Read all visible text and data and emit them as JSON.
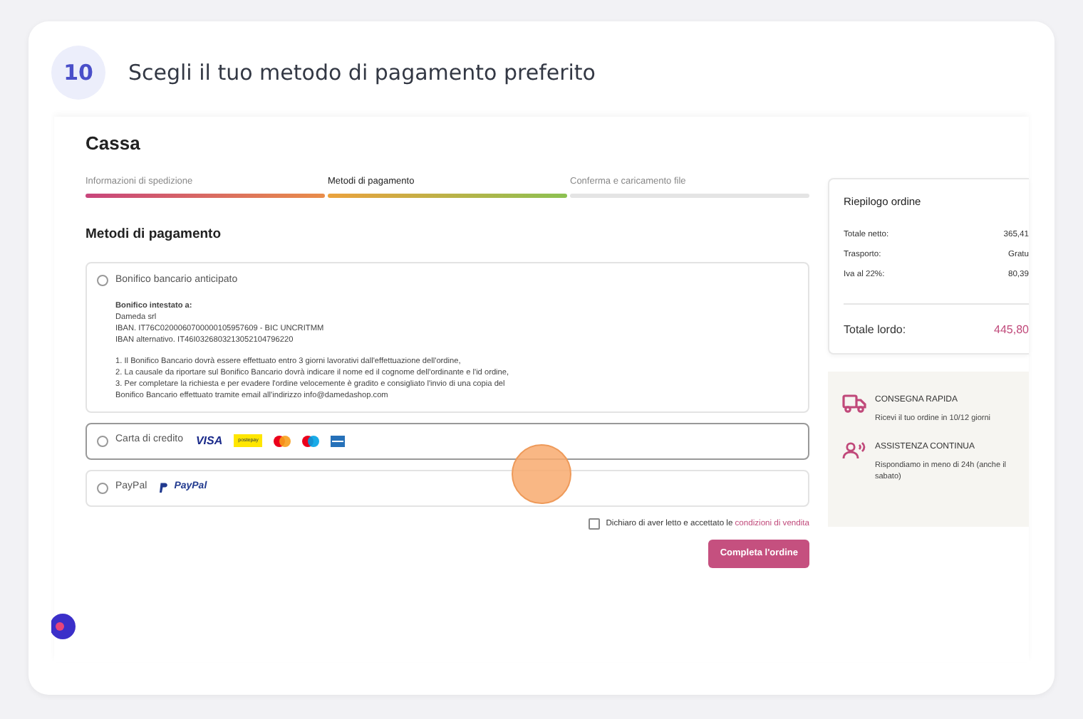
{
  "step": {
    "number": "10",
    "title": "Scegli il tuo metodo di pagamento preferito"
  },
  "checkout": {
    "title": "Cassa",
    "steps": [
      {
        "label": "Informazioni di spedizione",
        "completed": true,
        "selected": false
      },
      {
        "label": "Metodi di pagamento",
        "completed": false,
        "selected": true
      },
      {
        "label": "Conferma e caricamento file",
        "completed": false,
        "selected": false
      }
    ],
    "section_title": "Metodi di pagamento",
    "methods": [
      {
        "label": "Bonifico bancario anticipato",
        "selected": false,
        "hover": false,
        "details": {
          "heading": "Bonifico intestato a:",
          "lines": [
            "Dameda srl",
            "IBAN. IT76C0200060700000105957609 - BIC UNCRITMM",
            "IBAN alternativo. IT46I0326803213052104796220"
          ],
          "notes": [
            "1. Il Bonifico Bancario dovrà essere effettuato entro 3 giorni lavorativi dall'effettuazione dell'ordine,",
            "2. La causale da riportare sul Bonifico Bancario dovrà indicare il nome ed il cognome dell'ordinante e l'id ordine,",
            "3. Per completare la richiesta e per evadere l'ordine velocemente è gradito e consigliato l'invio di una copia del Bonifico Bancario effettuato tramite email all'indirizzo info@damedashop.com"
          ]
        }
      },
      {
        "label": "Carta di credito",
        "selected": false,
        "hover": true,
        "logos": [
          {
            "kind": "visa",
            "text": "VISA"
          },
          {
            "kind": "postepay",
            "text": "postepay"
          },
          {
            "kind": "mastercard"
          },
          {
            "kind": "maestro"
          },
          {
            "kind": "amex"
          }
        ]
      },
      {
        "label": "PayPal",
        "selected": false,
        "hover": false,
        "logos": [
          {
            "kind": "paypal",
            "text": "PayPal"
          }
        ]
      }
    ],
    "terms": {
      "checked": false,
      "text": "Dichiaro di aver letto e accettato le",
      "link": "condizioni di vendita"
    },
    "submit": "Completa l'ordine"
  },
  "summary": {
    "title": "Riepilogo ordine",
    "rows": [
      {
        "label": "Totale netto:",
        "value": "365,41"
      },
      {
        "label": "Trasporto:",
        "value": "Gratu"
      },
      {
        "label": "Iva al 22%:",
        "value": "80,39"
      }
    ],
    "total": {
      "label": "Totale lordo:",
      "value": "445,80"
    }
  },
  "features": [
    {
      "kind": "truck",
      "title": "CONSEGNA RAPIDA",
      "text": "Ricevi il tuo ordine in 10/12 giorni"
    },
    {
      "kind": "support",
      "title": "ASSISTENZA CONTINUA",
      "text": "Rispondiamo in meno di 24h (anche il sabato)"
    }
  ]
}
